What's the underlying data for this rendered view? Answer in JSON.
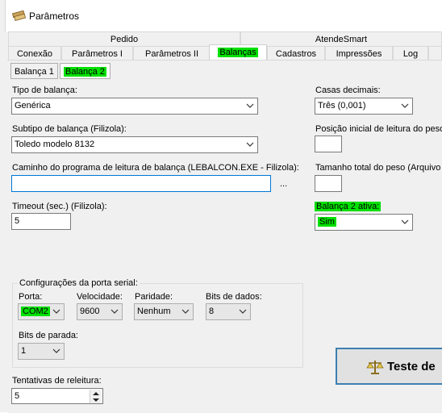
{
  "window": {
    "title": "Parâmetros"
  },
  "tabs_top_row": [
    "Pedido",
    "AtendeSmart"
  ],
  "tabs_bottom_row": [
    "Conexão",
    "Parâmetros I",
    "Parâmetros II",
    "Balanças",
    "Cadastros",
    "Impressões",
    "Log"
  ],
  "active_tab": "Balanças",
  "subtabs": [
    "Balança 1",
    "Balança 2"
  ],
  "active_subtab": "Balança 2",
  "fields": {
    "tipo_label": "Tipo de balança:",
    "tipo_value": "Genérica",
    "subtipo_label": "Subtipo de balança (Filizola):",
    "subtipo_value": "Toledo modelo 8132",
    "caminho_label": "Caminho do programa de leitura de balança (LEBALCON.EXE - Filizola):",
    "caminho_value": "",
    "browse_label": "...",
    "timeout_label": "Timeout (sec.) (Filizola):",
    "timeout_value": "5",
    "casas_label": "Casas decimais:",
    "casas_value": "Três (0,001)",
    "posicao_label": "Posição inicial de leitura do peso (",
    "posicao_value": "",
    "tamanho_label": "Tamanho total do peso (Arquivo",
    "tamanho_value": "",
    "ativa_label": "Balança 2 ativa:",
    "ativa_value": "Sim",
    "tentativas_label": "Tentativas de releitura:",
    "tentativas_value": "5"
  },
  "serial": {
    "group_label": "Configurações da porta serial:",
    "porta_label": "Porta:",
    "porta_value": "COM2",
    "velocidade_label": "Velocidade:",
    "velocidade_value": "9600",
    "paridade_label": "Paridade:",
    "paridade_value": "Nenhum",
    "bits_dados_label": "Bits de dados:",
    "bits_dados_value": "8",
    "bits_parada_label": "Bits de parada:",
    "bits_parada_value": "1"
  },
  "buttons": {
    "teste_label": "Teste de"
  },
  "colors": {
    "highlight": "#00e000",
    "focus_border": "#0078d7",
    "button_border": "#3c7fb1"
  }
}
